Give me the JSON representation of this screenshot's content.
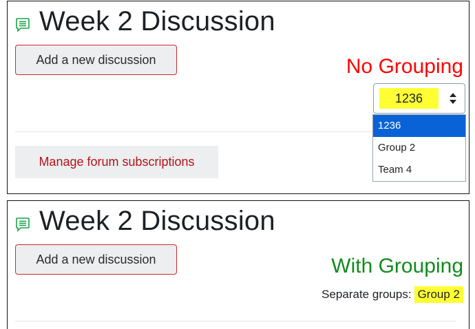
{
  "top_panel": {
    "title": "Week 2 Discussion",
    "add_button_label": "Add a new discussion",
    "annotation": "No Grouping",
    "group_select": {
      "selected_value": "1236",
      "options": [
        "1236",
        "Group 2",
        "Team 4"
      ]
    },
    "manage_subscriptions_label": "Manage forum subscriptions"
  },
  "bottom_panel": {
    "title": "Week 2 Discussion",
    "add_button_label": "Add a new discussion",
    "annotation": "With Grouping",
    "groups_label": "Separate groups:",
    "groups_value": "Group 2"
  },
  "icons": {
    "forum": "speech-bubble-list-icon",
    "select_arrow": "up-down-caret-icon"
  },
  "colors": {
    "no_grouping": "#ff0000",
    "with_grouping": "#118a1e",
    "highlight": "#ffff33",
    "selected_option": "#0a63d6",
    "manage_link": "#b3141a",
    "add_button_border": "#c92a2a"
  }
}
